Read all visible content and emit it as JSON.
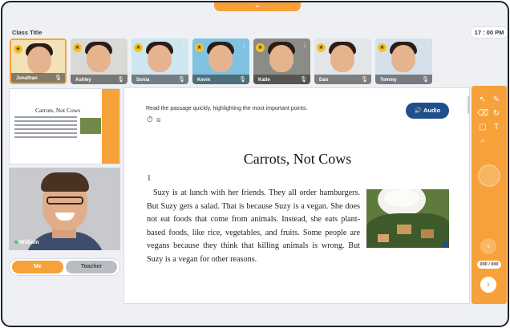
{
  "header": {
    "class_title": "Class Title",
    "clock": "17 : 00 PM",
    "collapse_icon": "chevron-down-icon"
  },
  "students": [
    {
      "name": "Jonathan",
      "active": true
    },
    {
      "name": "Ashley"
    },
    {
      "name": "Sonia"
    },
    {
      "name": "Kevin"
    },
    {
      "name": "Katie"
    },
    {
      "name": "Dan"
    },
    {
      "name": "Tommy"
    }
  ],
  "slide_preview": {
    "title": "Carrots, Not Cows"
  },
  "teacher": {
    "name": "William"
  },
  "view_toggle": {
    "me_label": "Me",
    "teacher_label": "Teacher",
    "selected": "Me"
  },
  "lesson": {
    "instruction": "Read the passage quickly, highlighting the most important points.",
    "audio_label": "Audio",
    "title": "Carrots, Not Cows",
    "paragraph_number": "1",
    "passage": "Suzy is at lunch with her friends. They all order hamburgers. But Suzy gets a salad. That is because Suzy is a vegan. She does not eat foods that come from animals. Instead, she eats plant-based foods, like rice, vegetables, and fruits. Some people are vegans because they think that killing animals is wrong. But Suzy is a vegan for other reasons."
  },
  "toolbar": {
    "tools": [
      "pointer-icon",
      "pen-icon",
      "eraser-icon",
      "redo-icon",
      "comment-icon",
      "text-icon",
      "search-icon"
    ],
    "page_indicator": "000 / 000"
  },
  "colors": {
    "accent": "#f6a13a",
    "audio_button": "#1f4e8c",
    "background": "#eef0f4"
  }
}
